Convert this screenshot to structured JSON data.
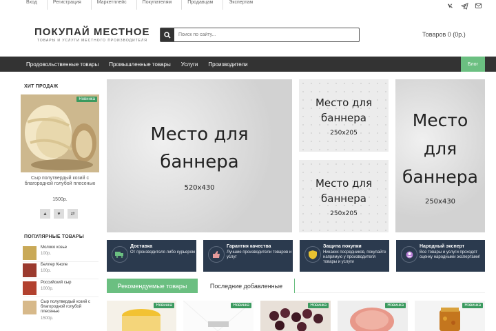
{
  "topbar": {
    "links": [
      "Вход",
      "Регистрация",
      "Маркетплейс",
      "Покупателям",
      "Продавцам",
      "Экспертам"
    ],
    "social": [
      "vk-icon",
      "telegram-icon",
      "mail-icon"
    ]
  },
  "header": {
    "brand_title": "ПОКУПАЙ МЕСТНОЕ",
    "brand_subtitle": "товары и услуги местного производителя",
    "search_placeholder": "Поиск по сайту...",
    "cart_text": "Товаров 0 (0р.)"
  },
  "nav": {
    "items": [
      "Продовольственные товары",
      "Промышленные товары",
      "Услуги",
      "Производители"
    ],
    "blog": "Блог"
  },
  "sidebar": {
    "hit_heading": "ХИТ ПРОДАЖ",
    "hit_badge": "Новинка",
    "hit_title": "Сыр полутвердый козий с благородной голубой плесенью",
    "hit_price": "1500р.",
    "popular_heading": "ПОПУЛЯРНЫЕ ТОВАРЫ",
    "popular": [
      {
        "name": "Молоко козье",
        "price": "100р."
      },
      {
        "name": "Беллер Кноле",
        "price": "100р."
      },
      {
        "name": "Российский сыр",
        "price": "1000р."
      },
      {
        "name": "Сыр полутвердый козий с благородной голубой плесенью",
        "price": "1500р."
      }
    ]
  },
  "banners": [
    {
      "title_lines": [
        "Место для",
        "баннера"
      ],
      "size": "520x430"
    },
    {
      "title_lines": [
        "Место для",
        "баннера"
      ],
      "size": "250x205"
    },
    {
      "title_lines": [
        "Место для",
        "баннера"
      ],
      "size": "250x205"
    },
    {
      "title_lines": [
        "Место",
        "для",
        "баннера"
      ],
      "size": "250x430"
    }
  ],
  "features": [
    {
      "title": "Доставка",
      "text": "От производителя либо курьером",
      "icon": "truck-icon"
    },
    {
      "title": "Гарантия качества",
      "text": "Лучшие производители товаров и услуг",
      "icon": "thumbs-up-icon"
    },
    {
      "title": "Защита покупки",
      "text": "Никаких посредников, покупайте напрямую у производителя товары и услуги",
      "icon": "shield-icon"
    },
    {
      "title": "Народный эксперт",
      "text": "Все товары и услуги проходят оценку народными экспертами!",
      "icon": "expert-icon"
    }
  ],
  "tabs": [
    "Рекомендуемые товары",
    "Последние добавленные"
  ],
  "products": [
    {
      "badge": "Новинка"
    },
    {
      "badge": "Новинка"
    },
    {
      "badge": "Новинка"
    },
    {
      "badge": "Новинка"
    },
    {
      "badge": "Новинка"
    }
  ],
  "colors": {
    "accent": "#6bbf81",
    "nav": "#333333",
    "feature_bg": "#2b3a4e",
    "badge": "#3b9a5f"
  }
}
